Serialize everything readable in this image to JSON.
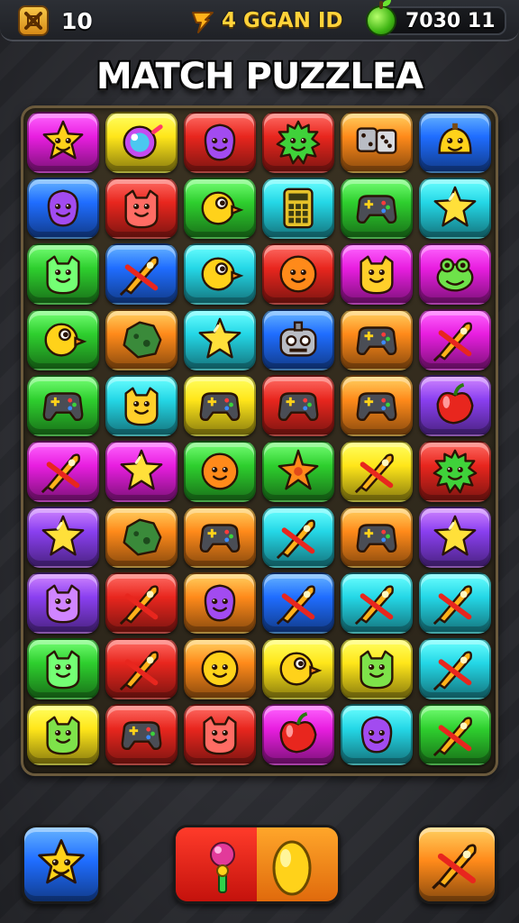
{
  "hud": {
    "level": "10",
    "gold_label": "4 GGAN ID",
    "score": "7030 11"
  },
  "title": "MATCH PUZZLEA",
  "colors": {
    "magenta": "#e81ee0",
    "yellow": "#ffe61a",
    "red": "#e8261e",
    "orange": "#ff8a1a",
    "blue": "#1f6dff",
    "cyan": "#24d7e6",
    "green": "#2ecf2e",
    "purple": "#8a3ff0"
  },
  "board": {
    "rows": [
      [
        {
          "color": "magenta",
          "icon": "star-face"
        },
        {
          "color": "yellow",
          "icon": "candy"
        },
        {
          "color": "red",
          "icon": "blob-face"
        },
        {
          "color": "red",
          "icon": "spiky-face"
        },
        {
          "color": "orange",
          "icon": "dice"
        },
        {
          "color": "blue",
          "icon": "bell-face"
        }
      ],
      [
        {
          "color": "blue",
          "icon": "blob-face"
        },
        {
          "color": "red",
          "icon": "cat-face"
        },
        {
          "color": "green",
          "icon": "bird-face"
        },
        {
          "color": "cyan",
          "icon": "calculator"
        },
        {
          "color": "green",
          "icon": "gamepad"
        },
        {
          "color": "cyan",
          "icon": "star"
        }
      ],
      [
        {
          "color": "green",
          "icon": "cat-face"
        },
        {
          "color": "blue",
          "icon": "rocket"
        },
        {
          "color": "cyan",
          "icon": "bird-face"
        },
        {
          "color": "red",
          "icon": "round-face"
        },
        {
          "color": "magenta",
          "icon": "cat-face"
        },
        {
          "color": "magenta",
          "icon": "frog-face"
        }
      ],
      [
        {
          "color": "green",
          "icon": "bird-face"
        },
        {
          "color": "orange",
          "icon": "rock"
        },
        {
          "color": "cyan",
          "icon": "star"
        },
        {
          "color": "blue",
          "icon": "robot"
        },
        {
          "color": "orange",
          "icon": "gamepad"
        },
        {
          "color": "magenta",
          "icon": "rocket"
        }
      ],
      [
        {
          "color": "green",
          "icon": "gamepad"
        },
        {
          "color": "cyan",
          "icon": "cat-face"
        },
        {
          "color": "yellow",
          "icon": "gamepad"
        },
        {
          "color": "red",
          "icon": "gamepad"
        },
        {
          "color": "orange",
          "icon": "gamepad"
        },
        {
          "color": "purple",
          "icon": "apple"
        }
      ],
      [
        {
          "color": "magenta",
          "icon": "rocket"
        },
        {
          "color": "magenta",
          "icon": "star"
        },
        {
          "color": "green",
          "icon": "round-face"
        },
        {
          "color": "green",
          "icon": "starfish"
        },
        {
          "color": "yellow",
          "icon": "rocket"
        },
        {
          "color": "red",
          "icon": "spiky-face"
        }
      ],
      [
        {
          "color": "purple",
          "icon": "star"
        },
        {
          "color": "orange",
          "icon": "rock"
        },
        {
          "color": "orange",
          "icon": "gamepad"
        },
        {
          "color": "cyan",
          "icon": "rocket"
        },
        {
          "color": "orange",
          "icon": "gamepad"
        },
        {
          "color": "purple",
          "icon": "star"
        }
      ],
      [
        {
          "color": "purple",
          "icon": "cat-face"
        },
        {
          "color": "red",
          "icon": "rocket"
        },
        {
          "color": "orange",
          "icon": "blob-face"
        },
        {
          "color": "blue",
          "icon": "rocket"
        },
        {
          "color": "cyan",
          "icon": "rocket"
        },
        {
          "color": "cyan",
          "icon": "rocket"
        }
      ],
      [
        {
          "color": "green",
          "icon": "cat-face"
        },
        {
          "color": "red",
          "icon": "rocket"
        },
        {
          "color": "orange",
          "icon": "round-face"
        },
        {
          "color": "yellow",
          "icon": "bird-face"
        },
        {
          "color": "yellow",
          "icon": "cat-face"
        },
        {
          "color": "cyan",
          "icon": "rocket"
        }
      ],
      [
        {
          "color": "yellow",
          "icon": "cat-face"
        },
        {
          "color": "red",
          "icon": "gamepad"
        },
        {
          "color": "red",
          "icon": "cat-face"
        },
        {
          "color": "magenta",
          "icon": "apple"
        },
        {
          "color": "cyan",
          "icon": "blob-face"
        },
        {
          "color": "green",
          "icon": "rocket"
        }
      ]
    ]
  },
  "bottom": {
    "left_button": {
      "color": "blue",
      "icon": "star-face"
    },
    "center_button": {
      "icon_left": "candy-wand",
      "icon_right": "yellow-gem"
    },
    "right_button": {
      "color": "orange",
      "icon": "rocket"
    }
  }
}
